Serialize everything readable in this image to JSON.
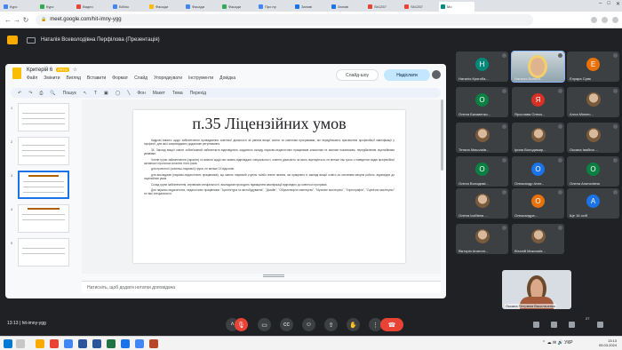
{
  "browser": {
    "tabs": [
      {
        "label": "Курс",
        "color": "#4285f4"
      },
      {
        "label": "Курс",
        "color": "#34a853"
      },
      {
        "label": "Видео",
        "color": "#ea4335"
      },
      {
        "label": "Бібліо",
        "color": "#4285f4"
      },
      {
        "label": "Фасади",
        "color": "#fbbc04"
      },
      {
        "label": "Фасади",
        "color": "#4285f4"
      },
      {
        "label": "Фасади",
        "color": "#34a853"
      },
      {
        "label": "Про пр",
        "color": "#4285f4"
      },
      {
        "label": "Запові",
        "color": "#1a73e8"
      },
      {
        "label": "Запові",
        "color": "#1a73e8"
      },
      {
        "label": "Sb1257",
        "color": "#ea4335"
      },
      {
        "label": "Sb1257",
        "color": "#ea4335"
      },
      {
        "label": "Мо",
        "color": "#00897b",
        "active": true
      }
    ],
    "url": "meet.google.com/hit-imny-ygg"
  },
  "meet": {
    "presenter_title": "Наталія Всеволодівна Перфілова (Презентація)",
    "time_code": "13:13 | hit-imny-ygg",
    "participant_count": "27"
  },
  "slides_app": {
    "doc_name": "Критерій 6",
    "badge": "PPTX",
    "menu": [
      "Файл",
      "Змінити",
      "Вигляд",
      "Вставити",
      "Формат",
      "Слайд",
      "Упорядкувати",
      "Інструменти",
      "Довідка"
    ],
    "slideshow_label": "Слайд-шоу",
    "share_label": "Надіслати",
    "toolbar": [
      "Пошук",
      "Фон",
      "Макет",
      "Тема",
      "Перехід"
    ],
    "thumb_numbers": [
      "1",
      "2",
      "3",
      "4",
      "5"
    ],
    "notes_placeholder": "Натисніть, щоб додати нотатки доповідача"
  },
  "slide": {
    "title": "п.35 Ліцензійних умов",
    "paragraphs": [
      "Кадрові вимоги щодо забезпечення провадження освітньої діяльності за рівнем вищої освіти та освітніми програмами, які передбачають присвоєння професійної кваліфікації у професії, для якої запроваджено додаткове регулювання.",
      "34. Заклад вищої освіти зобов'язаний забезпечити відповідність кадрового складу науково-педагогічних працівників кількісним та якісним показникам, передбаченим ліцензійними умовами.",
      "Члени групи забезпечення (гаранти) та вимоги щодо них мають відповідати спеціальності, освітня діяльність за якою ліцензується, не менше ніж трьох з наведених видів професійної активності протягом останніх п'яти років.",
      "для проектної (освітньо-наукової) групи, не менше 15 відсотків.",
      "для викладачів (науково-педагогічних працівників), що мають науковий ступінь та/або вчене звання, які працюють в закладі вищої освіти за основним місцем роботи, відповідно до ліцензійних умов.",
      "Склад групи забезпечення, керівників спеціальності, викладачів проходять підвищення кваліфікації відповідно до освітньої програми.",
      "Для науково-педагогічних, педагогічних працівників: \"Архітектура та містобудування\", \"Дизайн\", \"Образотворче мистецтво\", \"Музичне мистецтво\", \"Хореографія\", \"Сценічне мистецтво\" та інші спеціальності."
    ]
  },
  "participants": [
    {
      "initial": "Н",
      "name": "Наталія Кригоба...",
      "color": "#00897b",
      "type": "initial"
    },
    {
      "initial": "",
      "name": "Наталія Всевол...",
      "color": "",
      "type": "camera"
    },
    {
      "initial": "Е",
      "name": "Елуара Сумк",
      "color": "#e8710a",
      "type": "initial"
    },
    {
      "initial": "О",
      "name": "Олена Бахавенко...",
      "color": "#0b8043",
      "type": "initial"
    },
    {
      "initial": "Я",
      "name": "Ярослава Олеко...",
      "color": "#d93025",
      "type": "initial"
    },
    {
      "initial": "",
      "name": "Алла Міннеч...",
      "color": "",
      "type": "photo"
    },
    {
      "initial": "",
      "name": "Тетяна Миколаїв...",
      "color": "",
      "type": "photo"
    },
    {
      "initial": "",
      "name": "Ірина Володимир...",
      "color": "",
      "type": "photo"
    },
    {
      "initial": "",
      "name": "Оксана Івабіна ...",
      "color": "",
      "type": "photo"
    },
    {
      "initial": "О",
      "name": "Олеся Володимі...",
      "color": "#0b8043",
      "type": "initial"
    },
    {
      "initial": "О",
      "name": "Олександр Анат...",
      "color": "#1a73e8",
      "type": "initial"
    },
    {
      "initial": "О",
      "name": "Олена Анатолівна",
      "color": "#0b8043",
      "type": "initial"
    },
    {
      "initial": "",
      "name": "Олена Ісабівна ...",
      "color": "",
      "type": "photo"
    },
    {
      "initial": "О",
      "name": "Олександра...",
      "color": "#e8710a",
      "type": "initial"
    },
    {
      "initial": "А",
      "name": "Ще 16 осіб",
      "color": "#1a73e8",
      "type": "initial"
    },
    {
      "initial": "",
      "name": "Вікторія Анатолі...",
      "color": "",
      "type": "photo"
    },
    {
      "initial": "",
      "name": "Віталій Миколаїв...",
      "color": "",
      "type": "photo"
    }
  ],
  "self_view": {
    "name": "Оксана Петрівна Васильченко"
  },
  "taskbar": {
    "clock_time": "13:13",
    "clock_date": "05.03.2024",
    "lang": "УКР"
  }
}
